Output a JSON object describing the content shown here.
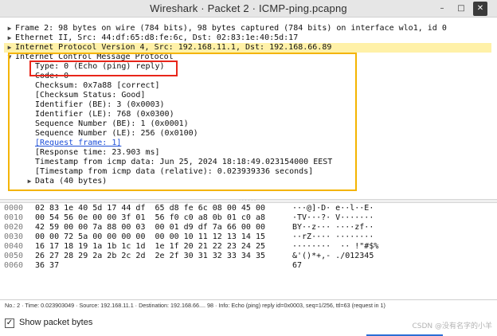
{
  "window": {
    "title": "Wireshark · Packet 2 · ICMP-ping.pcapng",
    "min_glyph": "–",
    "max_glyph": "□",
    "close_glyph": "✕"
  },
  "tree": {
    "frame": "Frame 2: 98 bytes on wire (784 bits), 98 bytes captured (784 bits) on interface wlo1, id 0",
    "ethernet": "Ethernet II, Src: 44:df:65:d8:fe:6c, Dst: 02:83:1e:40:5d:17",
    "ip": "Internet Protocol Version 4, Src: 192.168.11.1, Dst: 192.168.66.89",
    "icmp": "Internet Control Message Protocol",
    "icmp_fields": [
      "Type: 0 (Echo (ping) reply)",
      "Code: 0",
      "Checksum: 0x7a88 [correct]",
      "[Checksum Status: Good]",
      "Identifier (BE): 3 (0x0003)",
      "Identifier (LE): 768 (0x0300)",
      "Sequence Number (BE): 1 (0x0001)",
      "Sequence Number (LE): 256 (0x0100)",
      "[Request frame: 1]",
      "[Response time: 23.903 ms]",
      "Timestamp from icmp data: Jun 25, 2024 18:18:49.023154000 EEST",
      "[Timestamp from icmp data (relative): 0.023939336 seconds]"
    ],
    "data": "Data (40 bytes)"
  },
  "hex": [
    {
      "offset": "0000",
      "bytes": "02 83 1e 40 5d 17 44 df  65 d8 fe 6c 08 00 45 00",
      "ascii": "···@]·D· e··l··E·"
    },
    {
      "offset": "0010",
      "bytes": "00 54 56 0e 00 00 3f 01  56 f0 c0 a8 0b 01 c0 a8",
      "ascii": "·TV···?· V·······"
    },
    {
      "offset": "0020",
      "bytes": "42 59 00 00 7a 88 00 03  00 01 d9 df 7a 66 00 00",
      "ascii": "BY··z··· ····zf··"
    },
    {
      "offset": "0030",
      "bytes": "00 00 72 5a 00 00 00 00  00 00 10 11 12 13 14 15",
      "ascii": "··rZ···· ········"
    },
    {
      "offset": "0040",
      "bytes": "16 17 18 19 1a 1b 1c 1d  1e 1f 20 21 22 23 24 25",
      "ascii": "········  ·· !\"#$%"
    },
    {
      "offset": "0050",
      "bytes": "26 27 28 29 2a 2b 2c 2d  2e 2f 30 31 32 33 34 35",
      "ascii": "&'()*+,- ./012345"
    },
    {
      "offset": "0060",
      "bytes": "36 37",
      "ascii": "67"
    }
  ],
  "status": "No.: 2 · Time: 0.023903049 · Source: 192.168.11.1 · Destination: 192.168.66.... 98 · Info: Echo (ping) reply id=0x0003, seq=1/256, ttl=63 (request in 1)",
  "footer": {
    "show_bytes_label": "Show packet bytes",
    "show_bytes_checked": "✓",
    "watermark": "CSDN @没有名字的小羊"
  },
  "icons": {
    "collapsed": "▶",
    "expanded": "▼"
  },
  "colors": {
    "highlight": "#fff1a8",
    "annotation_yellow": "#f4b400",
    "annotation_red": "#e8261a",
    "link": "#1c4fd8"
  }
}
